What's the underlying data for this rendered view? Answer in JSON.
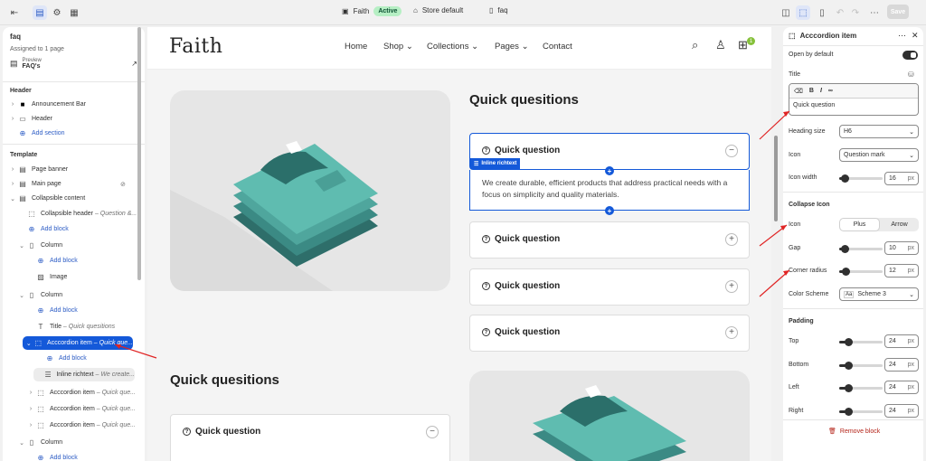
{
  "topbar": {
    "theme_name": "Faith",
    "status": "Active",
    "store": "Store default",
    "page": "faq",
    "save_label": "Save"
  },
  "left": {
    "page_name": "faq",
    "assigned": "Assigned to 1 page",
    "preview_label": "Preview",
    "preview_value": "FAQ's",
    "header_title": "Header",
    "header_items": [
      "Announcement Bar",
      "Header"
    ],
    "add_section": "Add section",
    "template_title": "Template",
    "items": [
      {
        "label": "Page banner",
        "sub": ""
      },
      {
        "label": "Main page",
        "sub": ""
      },
      {
        "label": "Collapsible content",
        "sub": ""
      },
      {
        "label": "Collapsible header",
        "sub": "– Question &..."
      },
      {
        "label": "Add block",
        "sub": ""
      },
      {
        "label": "Column",
        "sub": ""
      },
      {
        "label": "Add block",
        "sub": ""
      },
      {
        "label": "Image",
        "sub": ""
      },
      {
        "label": "Column",
        "sub": ""
      },
      {
        "label": "Add block",
        "sub": ""
      },
      {
        "label": "Title",
        "sub": "– Quick quesitions"
      },
      {
        "label": "Acccordion item",
        "sub": "– Quick que..."
      },
      {
        "label": "Add block",
        "sub": ""
      },
      {
        "label": "Inline richtext",
        "sub": "– We create..."
      },
      {
        "label": "Acccordion item",
        "sub": "– Quick que..."
      },
      {
        "label": "Acccordion item",
        "sub": "– Quick que..."
      },
      {
        "label": "Acccordion item",
        "sub": "– Quick que..."
      },
      {
        "label": "Column",
        "sub": ""
      },
      {
        "label": "Add block",
        "sub": ""
      }
    ]
  },
  "store": {
    "logo": "Faith",
    "nav": [
      "Home",
      "Shop",
      "Collections",
      "Pages",
      "Contact"
    ],
    "cart_count": "1",
    "section_title": "Quick quesitions",
    "accordion": [
      {
        "question": "Quick question",
        "open": true
      },
      {
        "question": "Quick question",
        "open": false
      },
      {
        "question": "Quick question",
        "open": false
      },
      {
        "question": "Quick question",
        "open": false
      }
    ],
    "answer": "We create durable, efficient products that address practical needs with a focus on simplicity and quality materials.",
    "inline_tag": "Inline richtext",
    "section2_title": "Quick quesitions",
    "section2_question": "Quick question"
  },
  "right": {
    "title": "Acccordion item",
    "open_by_default": "Open by default",
    "title_label": "Title",
    "title_value": "Quick question",
    "heading_size_label": "Heading size",
    "heading_size": "H6",
    "icon_label": "Icon",
    "icon_value": "Question mark",
    "icon_width_label": "Icon width",
    "icon_width": "16",
    "collapse_title": "Collapse Icon",
    "collapse_icon_label": "Icon",
    "collapse_options": [
      "Plus",
      "Arrow"
    ],
    "gap_label": "Gap",
    "gap": "10",
    "corner_label": "Corner radius",
    "corner": "12",
    "scheme_label": "Color Scheme",
    "scheme_value": "Scheme 3",
    "padding_title": "Padding",
    "top_label": "Top",
    "top": "24",
    "bottom_label": "Bottom",
    "bottom": "24",
    "left_label": "Left",
    "left": "24",
    "right_label": "Right",
    "right": "24",
    "unit": "px",
    "remove_label": "Remove block"
  }
}
